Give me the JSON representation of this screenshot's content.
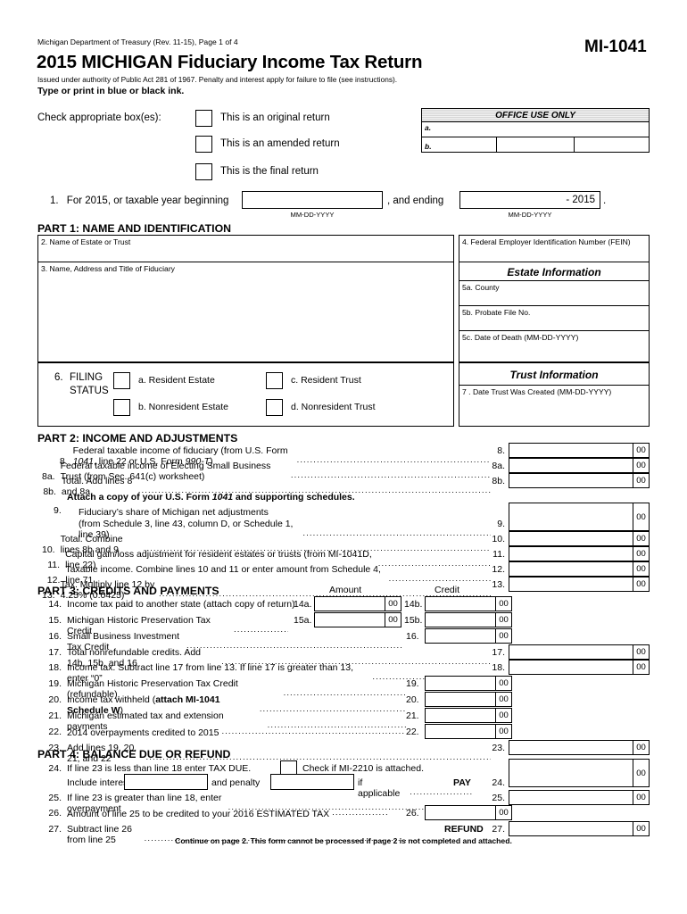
{
  "header": {
    "department_line": "Michigan Department of Treasury (Rev. 11-15), Page 1 of 4",
    "title": "2015 MICHIGAN Fiduciary Income Tax Return",
    "issued_line": "Issued under authority of Public Act 281 of 1967.  Penalty and interest apply for failure to file (see instructions).",
    "type_print": "Type or print in blue or black ink.",
    "form_number": "MI-1041"
  },
  "checkboxes": {
    "intro": "Check appropriate box(es):",
    "items": [
      "This is an original return",
      "This is an amended return",
      "This is the final return"
    ]
  },
  "office_use": {
    "title": "OFFICE USE ONLY",
    "row_a": "a.",
    "row_b": "b."
  },
  "line1": {
    "number": "1.",
    "text_before": "For 2015, or taxable year beginning",
    "text_middle": ", and ending",
    "ending_value": "- 2015",
    "text_after": ".",
    "date_format": "MM-DD-YYYY"
  },
  "part1": {
    "heading": "PART 1:  NAME AND IDENTIFICATION",
    "field2": "2. Name of Estate or Trust",
    "field3": "3. Name, Address and Title of Fiduciary",
    "field4": "4. Federal Employer Identification Number (FEIN)",
    "estate_information": "Estate Information",
    "field5a": "5a. County",
    "field5b": "5b. Probate File No.",
    "field5c": "5c. Date of Death (MM-DD-YYYY)",
    "trust_information": "Trust Information",
    "field7": "7 .  Date Trust Was Created (MM-DD-YYYY)"
  },
  "filing_status": {
    "number": "6.",
    "label_line1": "FILING",
    "label_line2": "STATUS",
    "options": [
      "a.  Resident Estate",
      "b.  Nonresident Estate",
      "c.  Resident Trust",
      "d.  Nonresident Trust"
    ]
  },
  "part2": {
    "heading": "PART 2:  INCOME AND ADJUSTMENTS",
    "lines": [
      {
        "no": "8.",
        "text": "Federal taxable income of fiduciary (from U.S. Form <i>1041</i>, line 22 or U.S. Form <i>990-T</i>)",
        "rno": "8.",
        "cents": "00"
      },
      {
        "no": "8a.",
        "text": "Federal taxable income of Electing Small Business Trust (from Sec. 641(c) worksheet)",
        "rno": "8a.",
        "cents": "00"
      },
      {
        "no": "8b.",
        "text": "Total. Add lines 8 and 8a",
        "rno": "8b.",
        "cents": "00"
      }
    ],
    "attach_note": "Attach a copy of your U.S. Form <i>1041</i> and supporting schedules.",
    "lines2": [
      {
        "no": "9.",
        "text": "Fiduciary&rsquo;s share of Michigan net adjustments",
        "text2": "(from Schedule 3, line 43, column D, or Schedule 1, line 39)",
        "rno": "9.",
        "cents": "00"
      },
      {
        "no": "10.",
        "text": "Total. Combine lines 8b and 9",
        "rno": "10.",
        "cents": "00"
      },
      {
        "no": "11.",
        "text": "Capital gain/loss adjustment for resident estates or trusts (from MI-1041D, line 22)",
        "rno": "11.",
        "cents": "00"
      },
      {
        "no": "12.",
        "text": "Taxable income. Combine lines 10 and 11 or enter amount from Schedule 4, line 71",
        "rno": "12.",
        "cents": "00"
      },
      {
        "no": "13.",
        "text": "Tax. Multiply line 12 by 4.25% (0.0425)",
        "rno": "13.",
        "cents": "00"
      }
    ]
  },
  "part3": {
    "heading": "PART 3:  CREDITS AND PAYMENTS",
    "col_amount": "Amount",
    "col_credit": "Credit",
    "line14": {
      "no": "14.",
      "text": "Income tax paid to another state (attach copy of return)",
      "a_label": "14a.",
      "a_cents": "00",
      "b_label": "14b.",
      "b_cents": "00"
    },
    "line15": {
      "no": "15.",
      "text": "Michigan Historic Preservation Tax Credit",
      "a_label": "15a.",
      "a_cents": "00",
      "b_label": "15b.",
      "b_cents": "00"
    },
    "line16": {
      "no": "16.",
      "text": "Small Business Investment Tax Credit",
      "label": "16.",
      "cents": "00"
    },
    "line17": {
      "no": "17.",
      "text": "Total nonrefundable credits.  Add 14b, 15b, and 16",
      "rno": "17.",
      "cents": "00"
    },
    "line18": {
      "no": "18.",
      "text": "Income tax. Subtract line 17 from line 13. If line 17 is greater than 13, enter &ldquo;0&rdquo;",
      "rno": "18.",
      "cents": "00"
    },
    "line19": {
      "no": "19.",
      "text": "Michigan Historic Preservation Tax Credit (refundable).",
      "label": "19.",
      "cents": "00"
    },
    "line20": {
      "no": "20.",
      "text": "Income tax withheld (<b>attach MI-1041 Schedule W</b>)",
      "label": "20.",
      "cents": "00"
    },
    "line21": {
      "no": "21.",
      "text": "Michigan estimated tax and extension payments",
      "label": "21.",
      "cents": "00"
    },
    "line22": {
      "no": "22.",
      "text": "2014 overpayments credited to 2015",
      "label": "22.",
      "cents": "00"
    },
    "line23": {
      "no": "23.",
      "text": "Add lines 19, 20, 21, and 22",
      "rno": "23.",
      "cents": "00"
    }
  },
  "part4": {
    "heading": "PART 4:  BALANCE DUE OR REFUND",
    "line24": {
      "no": "24.",
      "text": "If line 23 is less than line 18 enter TAX DUE.",
      "mi2210": "Check if MI-2210 is attached.",
      "include_interest": "Include interest",
      "and_penalty": "and penalty",
      "if_applicable": "if applicable",
      "pay": "PAY",
      "rno": "24.",
      "cents": "00"
    },
    "line25": {
      "no": "25.",
      "text": "If line 23 is greater than line 18, enter overpayment",
      "rno": "25.",
      "cents": "00"
    },
    "line26": {
      "no": "26.",
      "text": "Amount of line 25 to be credited to your 2016 ESTIMATED TAX",
      "label": "26.",
      "cents": "00"
    },
    "line27": {
      "no": "27.",
      "text": "Subtract line 26 from line 25",
      "refund": "REFUND",
      "rno": "27.",
      "cents": "00"
    }
  },
  "footer": {
    "note": "Continue on page 2. This form cannot be processed if page 2 is not completed and attached."
  }
}
